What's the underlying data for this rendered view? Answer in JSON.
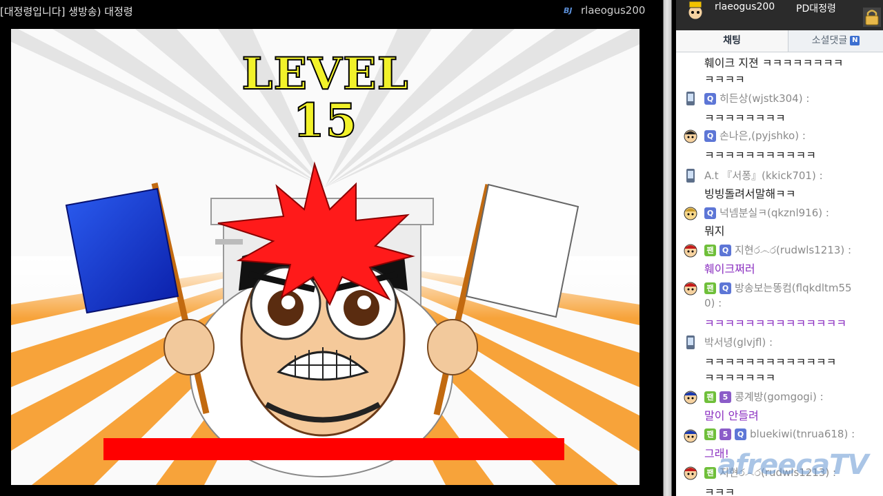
{
  "broadcast": {
    "title": "[대정령입니다] 생방송) 대정령",
    "bj_label": "BJ",
    "bj_name": "rlaeogus200"
  },
  "game": {
    "level_word": "LEVEL",
    "level_number": "15",
    "left_flag_color": "#1030d8",
    "right_flag_color": "#ffffff",
    "timer_bar_color": "#ff0000",
    "hair_color": "#ff1a1a"
  },
  "chat_header": {
    "user": "rlaeogus200",
    "role": "PD대정령",
    "lock_icon": "lock-icon"
  },
  "tabs": {
    "chat": "채팅",
    "social": "소셜댓글",
    "social_badge": "N"
  },
  "messages": [
    {
      "text": "훼이크 지젼 ㅋㅋㅋㅋㅋㅋㅋㅋ",
      "text2": "ㅋㅋㅋㅋ"
    },
    {
      "icon": "mobile-icon",
      "badges": [
        "Q"
      ],
      "user": "히든상(wjstk304) :",
      "text": "ㅋㅋㅋㅋㅋㅋㅋㅋ"
    },
    {
      "icon": "face-icon",
      "badges": [
        "Q"
      ],
      "user": "손나은,(pyjshko) :",
      "text": "ㅋㅋㅋㅋㅋㅋㅋㅋㅋㅋㅋ"
    },
    {
      "icon": "mobile-icon",
      "badges": [],
      "user": "A.t 『서퐁』(kkick701) :",
      "text": "빙빙돌려서말해ㅋㅋ"
    },
    {
      "icon": "face-icon",
      "badges": [
        "Q"
      ],
      "user": "넉넴분실ㅋ(qkznl916) :",
      "text": "뭐지"
    },
    {
      "icon": "face-icon",
      "badges": [
        "팬",
        "Q"
      ],
      "user": "지현ර෴ර(rudwls1213) :",
      "text": "훼이크쩌러"
    },
    {
      "icon": "face-icon",
      "badges": [
        "팬",
        "Q"
      ],
      "user": "방송보는똥컴(flqkdltm55",
      "user2": "0) :",
      "text": "ㅋㅋㅋㅋㅋㅋㅋㅋㅋㅋㅋㅋㅋㅋ"
    },
    {
      "icon": "mobile-icon",
      "badges": [],
      "user": "박서녕(glvjfl) :",
      "text": "ㅋㅋㅋㅋㅋㅋㅋㅋㅋㅋㅋㅋㅋ",
      "text2": "ㅋㅋㅋㅋㅋㅋㅋ"
    },
    {
      "icon": "face-icon",
      "badges": [
        "팬",
        "5"
      ],
      "user": "콩계방(gomgogi) :",
      "text": "말이 안들려"
    },
    {
      "icon": "face-icon",
      "badges": [
        "팬",
        "5",
        "Q"
      ],
      "user": "bluekiwi(tnrua618) :",
      "text": "그래!"
    },
    {
      "icon": "face-icon",
      "badges": [
        "팬"
      ],
      "user": "지현ර෴ර(rudwls1213) :",
      "text": "ㅋㅋㅋ"
    }
  ],
  "watermark": "afreecaTV"
}
